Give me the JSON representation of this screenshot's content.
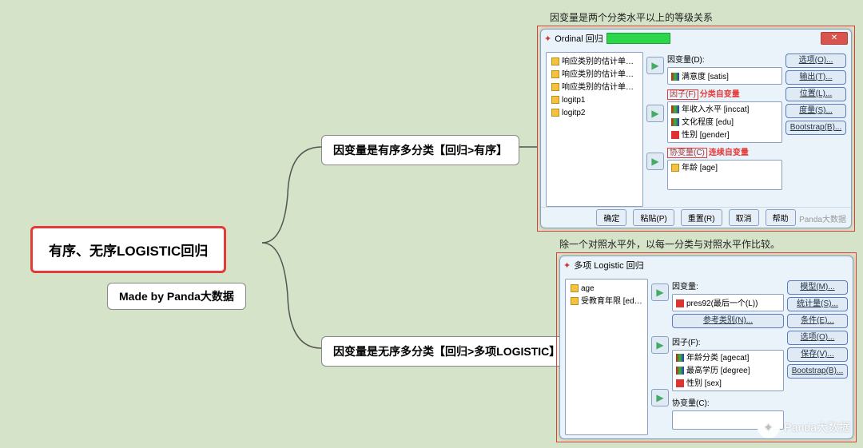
{
  "mindmap": {
    "root": "有序、无序LOGISTIC回归",
    "author": "Made by Panda大数据",
    "branch1": "因变量是有序多分类【回归>有序】",
    "branch2": "因变量是无序多分类【回归>多项LOGISTIC】"
  },
  "annot1": "因变量是两个分类水平以上的等级关系",
  "annot2": "除一个对照水平外，以每一分类与对照水平作比较。",
  "dialog1": {
    "title": "Ordinal 回归",
    "vars": [
      "响应类别的估计单元...",
      "响应类别的估计单元...",
      "响应类别的估计单元...",
      "logitp1",
      "logitp2"
    ],
    "dep_label": "因变量(D):",
    "dep_value": "满意度 [satis]",
    "factor_label": "因子(F)",
    "factor_note": "分类自变量",
    "factors": [
      "年收入水平 [inccat]",
      "文化程度 [edu]",
      "性别 [gender]"
    ],
    "cov_label": "协变量(C)",
    "cov_note": "连续自变量",
    "covs": [
      "年龄 [age]"
    ],
    "buttons": [
      "选项(O)...",
      "输出(T)...",
      "位置(L)...",
      "度量(S)...",
      "Bootstrap(B)..."
    ],
    "bottom": {
      "ok": "确定",
      "paste": "粘贴(P)",
      "reset": "重置(R)",
      "cancel": "取消",
      "help": "帮助"
    },
    "credit": "Panda大数据"
  },
  "dialog2": {
    "title": "多项 Logistic 回归",
    "vars": [
      "age",
      "受教育年限 [educ]"
    ],
    "dep_label": "因变量:",
    "dep_value": "pres92(最后一个(L))",
    "ref_btn": "参考类别(N)...",
    "factor_label": "因子(F):",
    "factors": [
      "年龄分类 [agecat]",
      "最高学历 [degree]",
      "性别 [sex]"
    ],
    "cov_label": "协变量(C):",
    "buttons": [
      "模型(M)...",
      "统计量(S)...",
      "条件(E)...",
      "选项(O)...",
      "保存(V)...",
      "Bootstrap(B)..."
    ]
  },
  "watermark": "Panda大数据"
}
